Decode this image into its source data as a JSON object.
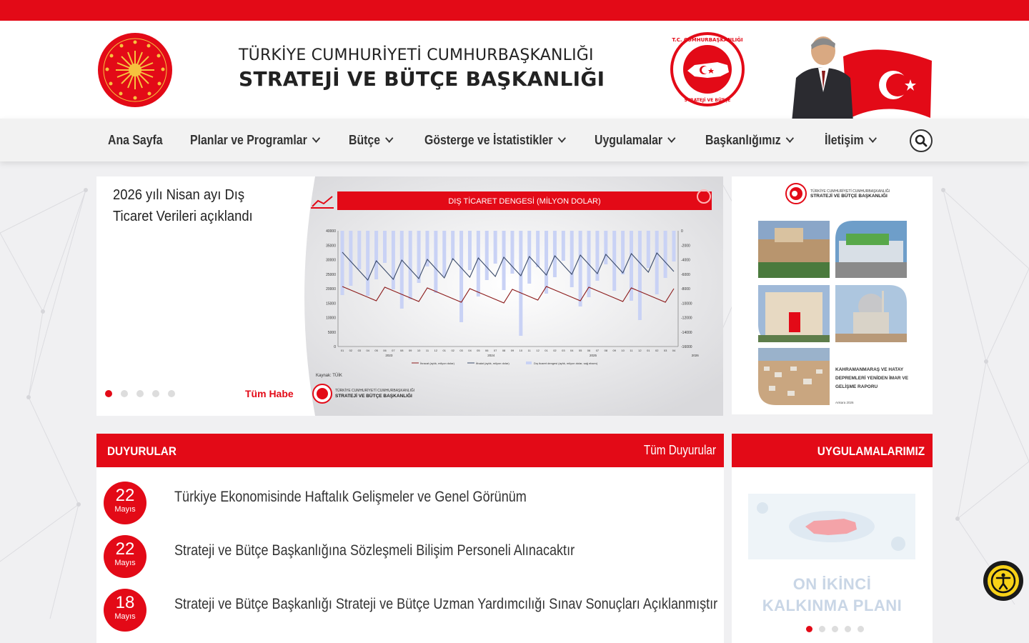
{
  "header": {
    "title_line1": "TÜRKİYE CUMHURİYETİ CUMHURBAŞKANLIĞI",
    "title_line2": "STRATEJİ VE BÜTÇE BAŞKANLIĞI",
    "seal_text": "T.C. CUMHURBAŞKANLIĞI STRATEJİ VE BÜTÇE BAŞKANLIĞI"
  },
  "nav": {
    "items": [
      {
        "label": "Ana Sayfa",
        "dropdown": false
      },
      {
        "label": "Planlar ve Programlar",
        "dropdown": true
      },
      {
        "label": "Bütçe",
        "dropdown": true
      },
      {
        "label": "Gösterge ve İstatistikler",
        "dropdown": true
      },
      {
        "label": "Uygulamalar",
        "dropdown": true
      },
      {
        "label": "Başkanlığımız",
        "dropdown": true
      },
      {
        "label": "İletişim",
        "dropdown": true
      }
    ],
    "search_icon": "search-icon"
  },
  "slider": {
    "title": "2026 yılı Nisan ayı Dış Ticaret Verileri açıklandı",
    "all_news_label": "Tüm Haberler",
    "dot_count": 5,
    "active_dot": 0,
    "image": {
      "chart_title": "DIŞ TİCARET DENGESİ (MİLYON DOLAR)",
      "source": "Kaynak: TÜİK",
      "legend": [
        "İhracat (aylık, milyon dolar)",
        "İthalat (aylık, milyon dolar)",
        "Dış ticaret dengesi (aylık, milyon dolar, sağ eksen)"
      ],
      "left_ticks": [
        "40000",
        "35000",
        "30000",
        "25000",
        "20000",
        "15000",
        "10000",
        "5000",
        "0"
      ],
      "right_ticks": [
        "0",
        "-2000",
        "-4000",
        "-6000",
        "-8000",
        "-10000",
        "-12000",
        "-14000",
        "-16000"
      ],
      "years": [
        "2023",
        "2024",
        "2025",
        "2026"
      ],
      "logo_line1": "TÜRKİYE CUMHURİYETİ CUMHURBAŞKANLIĞI",
      "logo_line2": "STRATEJİ VE BÜTÇE BAŞKANLIĞI"
    }
  },
  "report": {
    "header_line1": "TÜRKİYE CUMHURİYETİ CUMHURBAŞKANLIĞI",
    "header_line2": "STRATEJİ VE BÜTÇE BAŞKANLIĞI",
    "caption_line1": "KAHRAMANMARAŞ VE HATAY",
    "caption_line2": "DEPREMLERİ YENİDEN İMAR VE",
    "caption_line3": "GELİŞME RAPORU",
    "footer": "Ankara 2026"
  },
  "announcements": {
    "title": "DUYURULAR",
    "all_label": "Tüm Duyurular",
    "items": [
      {
        "day": "22",
        "month": "Mayıs",
        "text": "Türkiye Ekonomisinde Haftalık Gelişmeler ve Genel Görünüm"
      },
      {
        "day": "22",
        "month": "Mayıs",
        "text": "Strateji ve Bütçe Başkanlığına Sözleşmeli Bilişim Personeli Alınacaktır"
      },
      {
        "day": "18",
        "month": "Mayıs",
        "text": "Strateji ve Bütçe Başkanlığı Strateji ve Bütçe Uzman Yardımcılığı Sınav Sonuçları Açıklanmıştır"
      }
    ]
  },
  "apps": {
    "title": "UYGULAMALARIMIZ",
    "caption_line1": "ON İKİNCİ",
    "caption_line2": "KALKINMA PLANI",
    "dot_count": 5,
    "active_dot": 0
  },
  "accessibility": {
    "icon": "accessibility-icon"
  },
  "colors": {
    "brand_red": "#e30a17",
    "nav_bg": "#f2f2f2",
    "text_dark": "#333333"
  }
}
